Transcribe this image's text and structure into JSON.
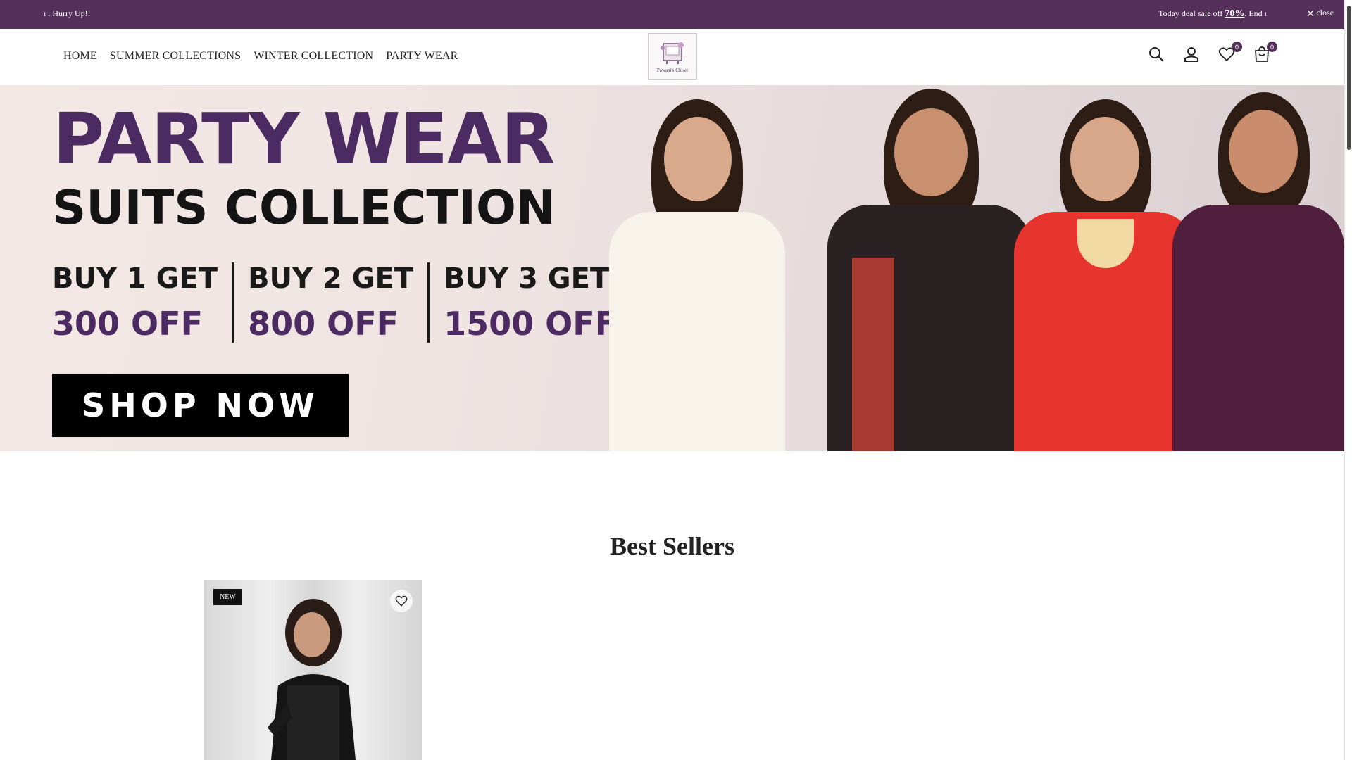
{
  "announcement": {
    "left_text": "ı . Hurry Up!!",
    "right_prefix": "Today deal sale off",
    "right_percent": "70%",
    "right_suffix": ". End ı",
    "close_label": "close"
  },
  "nav": {
    "items": [
      {
        "label": "HOME"
      },
      {
        "label": "SUMMER COLLECTIONS"
      },
      {
        "label": "WINTER COLLECTION"
      },
      {
        "label": "PARTY WEAR"
      }
    ]
  },
  "logo": {
    "caption": "Pawani's Closet"
  },
  "header_icons": {
    "wishlist_count": "0",
    "cart_count": "0"
  },
  "hero": {
    "headline": "PARTY WEAR",
    "subheadline": "SUITS COLLECTION",
    "offers": [
      {
        "line1": "BUY 1 GET",
        "line2": "300 OFF"
      },
      {
        "line1": "BUY 2 GET",
        "line2": "800 OFF"
      },
      {
        "line1": "BUY 3 GET",
        "line2": "1500 OFF"
      }
    ],
    "cta": "SHOP NOW"
  },
  "best_sellers": {
    "title": "Best Sellers",
    "products": [
      {
        "badge": "NEW"
      }
    ]
  },
  "colors": {
    "brand": "#54305a",
    "headline_purple": "#4c2b63"
  }
}
